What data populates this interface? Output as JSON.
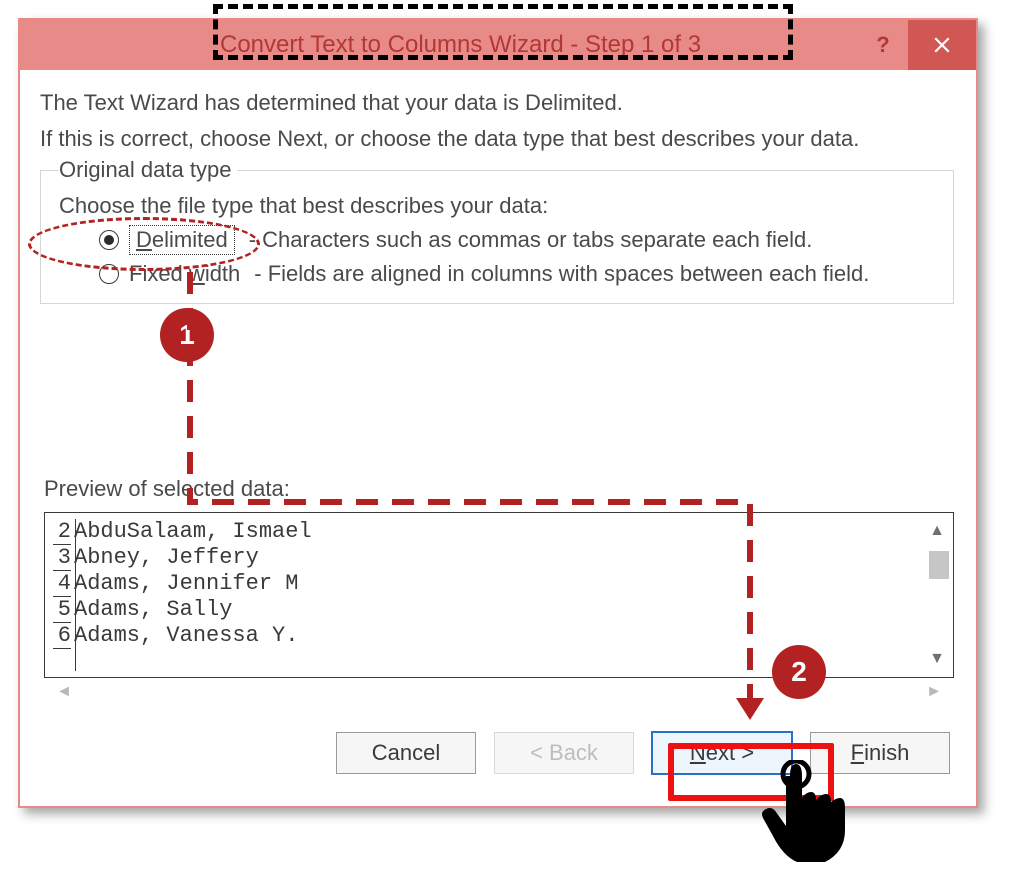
{
  "title": "Convert Text to Columns Wizard - Step 1 of 3",
  "help_symbol": "?",
  "intro": "The Text Wizard has determined that your data is Delimited.",
  "sub": "If this is correct, choose Next, or choose the data type that best describes your data.",
  "fieldset_label": "Original data type",
  "field_desc": "Choose the file type that best describes your data:",
  "radios": {
    "delimited": {
      "prefix": "D",
      "rest": "elimited",
      "desc": "- Characters such as commas or tabs separate each field."
    },
    "fixed": {
      "label_pre": "Fixed ",
      "key": "w",
      "label_post": "idth",
      "desc": "- Fields are aligned in columns with spaces between each field."
    }
  },
  "preview_label": "Preview of selected data:",
  "preview_rows": [
    {
      "n": "2",
      "text": "AbduSalaam, Ismael"
    },
    {
      "n": "3",
      "text": "Abney, Jeffery"
    },
    {
      "n": "4",
      "text": "Adams, Jennifer M"
    },
    {
      "n": "5",
      "text": "Adams, Sally"
    },
    {
      "n": "6",
      "text": "Adams, Vanessa Y."
    }
  ],
  "buttons": {
    "cancel": "Cancel",
    "back": "< Back",
    "next_key": "N",
    "next_rest": "ext >",
    "finish_key": "F",
    "finish_rest": "inish"
  },
  "callouts": {
    "one": "1",
    "two": "2"
  }
}
